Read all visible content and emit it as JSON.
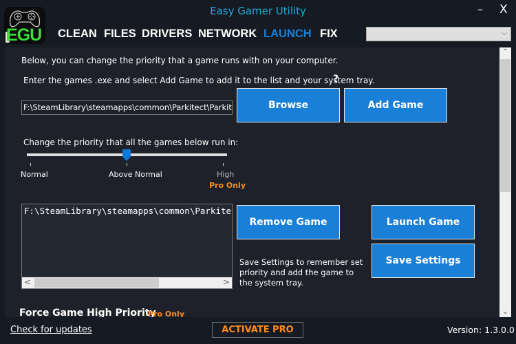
{
  "window": {
    "title": "Easy Gamer Utility",
    "minimize_glyph": "–",
    "close_glyph": "X"
  },
  "logo": {
    "text": "EGU",
    "icon": "gamepad-icon"
  },
  "nav": {
    "items": [
      {
        "label": "CLEAN",
        "active": false
      },
      {
        "label": "FILES",
        "active": false
      },
      {
        "label": "DRIVERS",
        "active": false
      },
      {
        "label": "NETWORK",
        "active": false
      },
      {
        "label": "LAUNCH",
        "active": true
      },
      {
        "label": "FIX",
        "active": false
      }
    ]
  },
  "dropdown": {
    "selected": "",
    "chevron": "⌵"
  },
  "launch": {
    "intro_text": "Below, you can change the priority that a game runs with on your computer.",
    "enter_text": "Enter the games .exe and select Add Game to add it to the list and your system tray.",
    "help_glyph": "?",
    "exe_input_value": "F:\\SteamLibrary\\steamapps\\common\\Parkitect\\Parkitect.exe",
    "browse_label": "Browse",
    "add_game_label": "Add Game",
    "priority_label": "Change the priority that all the games below run in:",
    "priority_options": [
      "Normal",
      "Above Normal",
      "High"
    ],
    "priority_selected_index": 1,
    "pro_only_label": "Pro Only",
    "game_list": [
      "F:\\SteamLibrary\\steamapps\\common\\Parkitect\\Parkitect.exe"
    ],
    "remove_game_label": "Remove Game",
    "launch_game_label": "Launch Game",
    "save_settings_label": "Save Settings",
    "save_note": "Save Settings to remember set priority and add the game to the system tray.",
    "force_title": "Force Game High Priority",
    "force_pro_label": "Pro Only"
  },
  "scrollbars": {
    "left_glyph": "<",
    "right_glyph": ">",
    "up_glyph": "⌃",
    "down_glyph": "⌄"
  },
  "footer": {
    "check_updates": "Check for updates",
    "activate_pro": "ACTIVATE PRO",
    "version": "Version: 1.3.0.0"
  },
  "colors": {
    "accent_blue": "#1a7fd6",
    "title_cyan": "#1fa9d6",
    "pro_orange": "#ff8c1a",
    "logo_green": "#3fe23a",
    "background": "#161a22",
    "panel": "#1e212a"
  }
}
